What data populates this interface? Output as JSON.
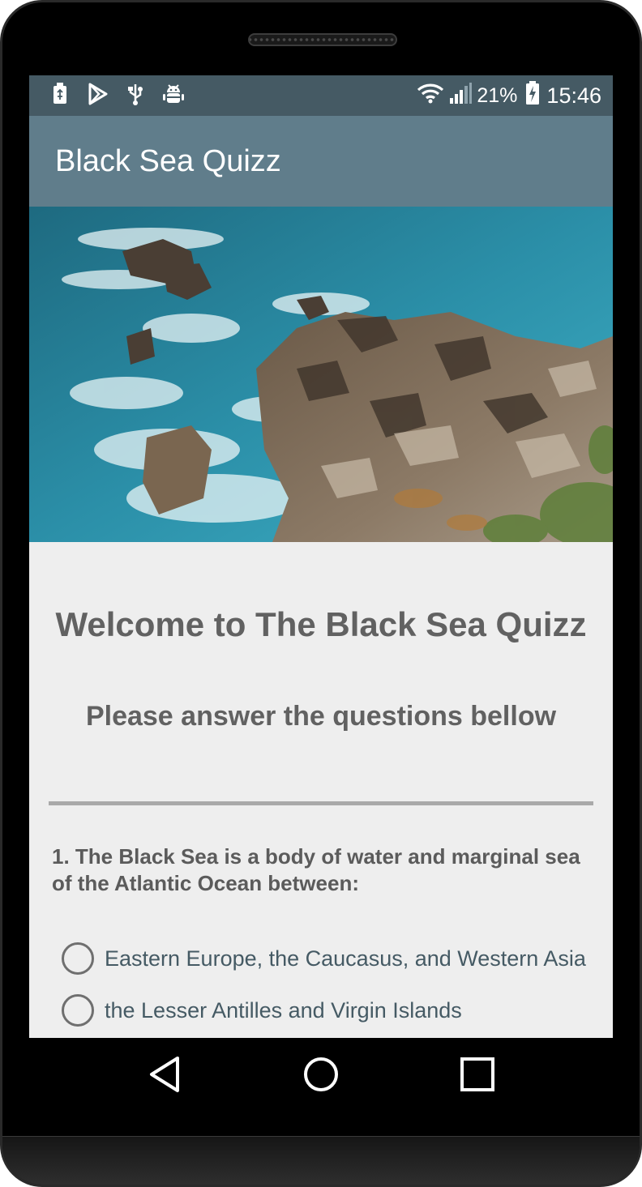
{
  "status_bar": {
    "battery_percent": "21%",
    "time": "15:46",
    "icons": [
      "sd-card-icon",
      "play-store-icon",
      "usb-icon",
      "android-debug-icon",
      "wifi-icon",
      "signal-icon",
      "battery-charging-icon"
    ]
  },
  "app_bar": {
    "title": "Black Sea Quizz"
  },
  "hero": {
    "description_icon": "coastline-image"
  },
  "quiz": {
    "welcome": "Welcome to The Black Sea Quizz",
    "subtitle": "Please answer the questions bellow",
    "questions": [
      {
        "text": "1. The Black Sea is a body of water and marginal sea of the Atlantic Ocean between:",
        "options": [
          "Eastern Europe, the Caucasus, and Western Asia",
          "the Lesser Antilles and Virgin Islands"
        ]
      }
    ]
  },
  "nav_bar": {
    "icons": [
      "back-icon",
      "home-icon",
      "recents-icon"
    ]
  },
  "colors": {
    "status_bar": "#455a64",
    "app_bar": "#607d8b",
    "background": "#eeeeee",
    "heading_text": "#616161",
    "option_text": "#455a64"
  }
}
